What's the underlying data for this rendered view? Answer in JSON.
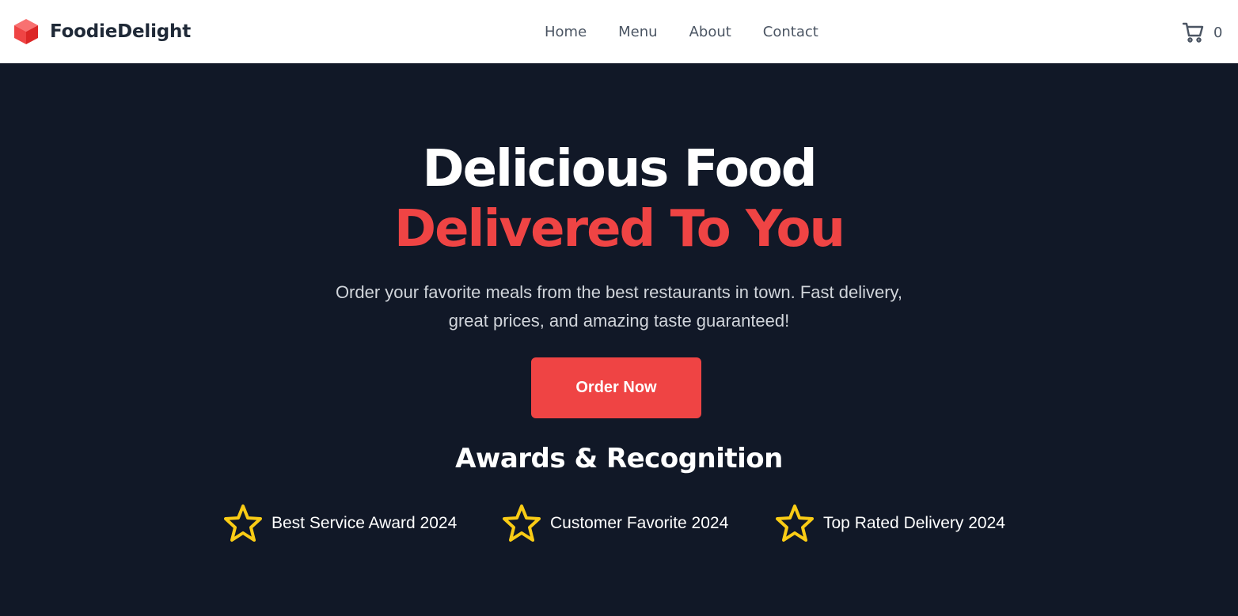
{
  "header": {
    "brand_name": "FoodieDelight",
    "brand_icon": "cube-icon",
    "nav_links": [
      {
        "label": "Home"
      },
      {
        "label": "Menu"
      },
      {
        "label": "About"
      },
      {
        "label": "Contact"
      }
    ],
    "cart_icon": "shopping-cart-icon",
    "cart_count": "0"
  },
  "hero": {
    "headline_line1": "Delicious Food",
    "headline_line2": "Delivered To You",
    "subtitle": "Order your favorite meals from the best restaurants in town. Fast delivery, great prices, and amazing taste guaranteed!",
    "cta_label": "Order Now"
  },
  "awards": {
    "title": "Awards & Recognition",
    "icon": "star-icon",
    "items": [
      {
        "label": "Best Service Award 2024"
      },
      {
        "label": "Customer Favorite 2024"
      },
      {
        "label": "Top Rated Delivery 2024"
      }
    ]
  },
  "colors": {
    "accent": "#ef4444",
    "background_dark": "#111827",
    "star": "#facc15",
    "nav_text": "#4b5563",
    "brand_text": "#1f2937"
  }
}
